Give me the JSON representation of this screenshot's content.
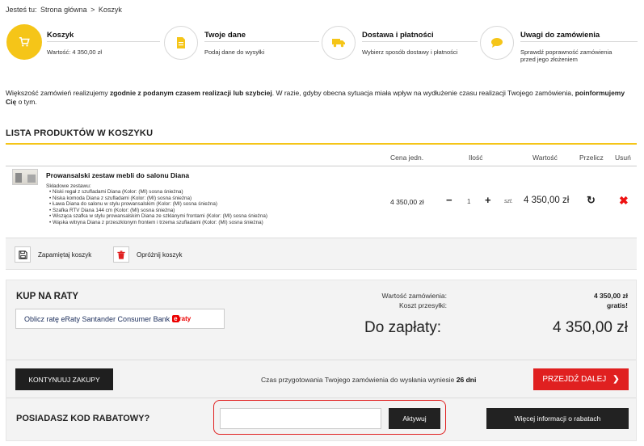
{
  "breadcrumb": {
    "prefix": "Jesteś tu:",
    "items": [
      "Strona główna",
      "Koszyk"
    ],
    "separator": ">"
  },
  "steps": [
    {
      "title": "Koszyk",
      "sub": "Wartość: 4 350,00 zł",
      "icon": "cart-icon",
      "active": true
    },
    {
      "title": "Twoje dane",
      "sub": "Podaj dane do wysyłki",
      "icon": "document-icon",
      "active": false
    },
    {
      "title": "Dostawa i płatności",
      "sub": "Wybierz sposób dostawy i płatności",
      "icon": "truck-icon",
      "active": false
    },
    {
      "title": "Uwagi do zamówienia",
      "sub1": "Sprawdź poprawność zamówienia",
      "sub2": "przed jego złożeniem",
      "icon": "speech-bubble-icon",
      "active": false
    }
  ],
  "info": {
    "part1": "Większość zamówień realizujemy ",
    "bold1": "zgodnie z podanym czasem realizacji lub szybciej",
    "part2": ". W razie, gdyby obecna sytuacja miała wpływ na wydłużenie czasu realizacji Twojego zamówienia, ",
    "bold2": "poinformujemy Cię",
    "part3": " o tym."
  },
  "list": {
    "title": "LISTA PRODUKTÓW W KOSZYKU",
    "columns": {
      "price": "Cena jedn.",
      "qty": "Ilość",
      "value": "Wartość",
      "recalc": "Przelicz",
      "remove": "Usuń"
    }
  },
  "product": {
    "name": "Prowansalski zestaw mebli do salonu Diana",
    "components_label": "Składowe zestawu:",
    "components": [
      "Niski regał z szufladami Diana (Kolor: (MI) sosna śnieżna)",
      "Niska komoda Diana z szufladami (Kolor: (MI) sosna śnieżna)",
      "Ława Diana do salonu w stylu prowansalskim (Kolor: (MI) sosna śnieżna)",
      "Szafka RTV Diana 144 cm (Kolor: (MI) sosna śnieżna)",
      "Wisząca szafka w stylu prowansalskim Diana ze szklanymi frontami (Kolor: (MI) sosna śnieżna)",
      "Wąska witryna Diana z przeszklonym frontem i trzema szufladami (Kolor: (MI) sosna śnieżna)"
    ],
    "unit_price": "4 350,00 zł",
    "qty": "1",
    "minus": "−",
    "plus": "+",
    "unit": "szt.",
    "value": "4 350,00 zł",
    "recalc_glyph": "↻",
    "remove_glyph": "✖"
  },
  "cart_actions": {
    "save": "Zapamiętaj koszyk",
    "clear": "Opróżnij koszyk"
  },
  "summary": {
    "raty_title": "KUP NA RATY",
    "raty_button": "Oblicz ratę eRaty Santander Consumer Bank",
    "raty_logo_e": "e",
    "raty_logo_rest": "raty",
    "order_value_label": "Wartość zamówienia:",
    "order_value": "4 350,00 zł",
    "shipping_label": "Koszt przesyłki:",
    "shipping_value": "gratis!",
    "to_pay_label": "Do zapłaty:",
    "to_pay_value": "4 350,00 zł"
  },
  "actions": {
    "continue": "KONTYNUUJ ZAKUPY",
    "prep_text": "Czas przygotowania Twojego zamówienia do wysłania wyniesie",
    "prep_days": "26 dni",
    "next": "PRZEJDŹ DALEJ",
    "next_chevron": "❯"
  },
  "coupon": {
    "title": "POSIADASZ KOD RABATOWY?",
    "input_value": "",
    "input_placeholder": "",
    "apply": "Aktywuj",
    "more": "Więcej informacji o rabatach"
  },
  "colors": {
    "accent": "#f5c518",
    "primary_red": "#e02020",
    "dark": "#222222"
  }
}
